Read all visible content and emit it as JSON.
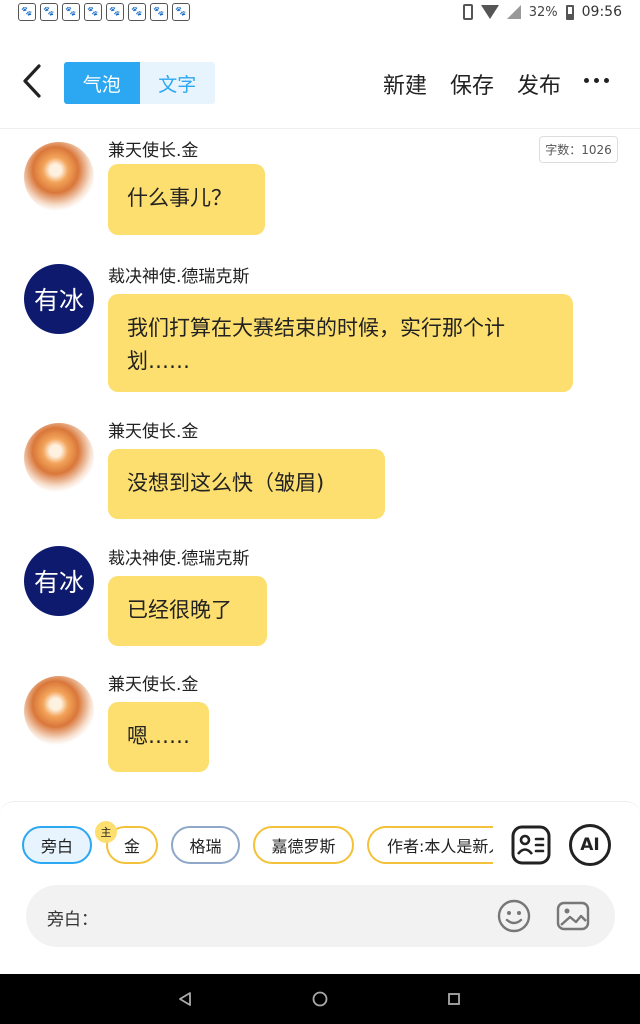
{
  "status_bar": {
    "battery": "32%",
    "time": "09:56"
  },
  "header": {
    "tabs": [
      {
        "label": "气泡",
        "active": true
      },
      {
        "label": "文字",
        "active": false
      }
    ],
    "actions": {
      "new": "新建",
      "save": "保存",
      "publish": "发布"
    }
  },
  "word_count": "字数：1026",
  "messages": [
    {
      "speaker": "兼天使长.金",
      "avatar": "kin-avatar",
      "text": "什么事儿？"
    },
    {
      "speaker": "裁决神使.德瑞克斯",
      "avatar": "drex-avatar",
      "avatar_text": "有冰",
      "text": "我们打算在大赛结束的时候，实行那个计划……"
    },
    {
      "speaker": "兼天使长.金",
      "avatar": "kin-avatar",
      "text": "没想到这么快（皱眉)"
    },
    {
      "speaker": "裁决神使.德瑞克斯",
      "avatar": "drex-avatar",
      "avatar_text": "有冰",
      "text": "已经很晚了"
    },
    {
      "speaker": "兼天使长.金",
      "avatar": "kin-avatar",
      "text": "嗯……"
    }
  ],
  "roles": [
    {
      "label": "旁白",
      "selected": true
    },
    {
      "label": "金",
      "badge": "主"
    },
    {
      "label": "格瑞"
    },
    {
      "label": "嘉德罗斯"
    },
    {
      "label": "作者:本人是新人"
    }
  ],
  "input": {
    "label": "旁白："
  },
  "icons": {
    "role_card": "role-card-icon",
    "ai": "AI",
    "emoji": "emoji-icon",
    "image": "image-icon"
  },
  "colors": {
    "accent": "#2ba8f1",
    "bubble": "#fddf6f",
    "chip_yellow": "#f3c23a"
  }
}
